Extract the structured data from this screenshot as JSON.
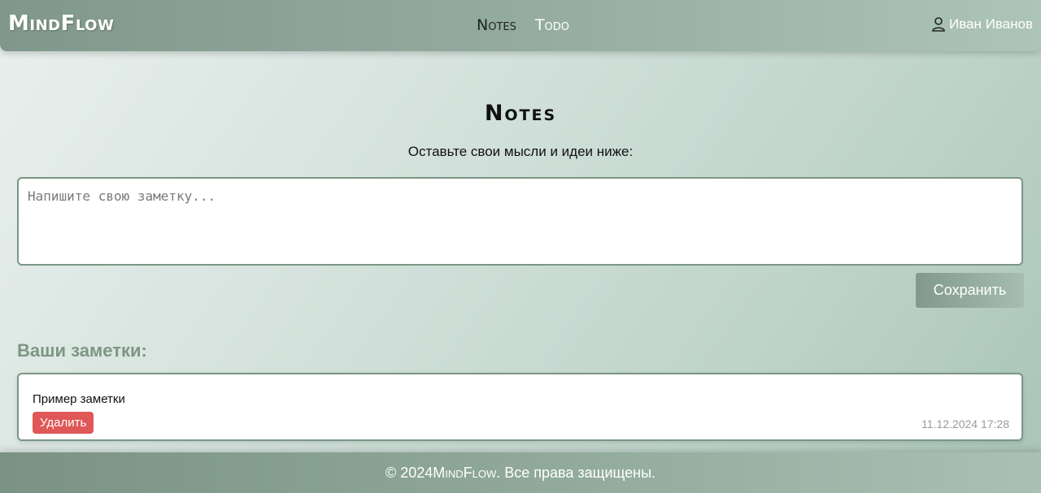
{
  "header": {
    "logo": "MindFlow",
    "nav": [
      {
        "label": "Notes",
        "active": true
      },
      {
        "label": "Todo",
        "active": false
      }
    ],
    "user_name": "Иван Иванов",
    "user_icon": "user-icon"
  },
  "main": {
    "title": "Notes",
    "subtitle": "Оставьте свои мысли и идеи ниже:",
    "input": {
      "value": "",
      "placeholder": "Напишите свою заметку..."
    },
    "save_label": "Сохранить",
    "notes_heading": "Ваши заметки:",
    "notes": [
      {
        "text": "Пример заметки",
        "delete_label": "Удалить",
        "date": "11.12.2024 17:28"
      }
    ]
  },
  "footer": {
    "prefix": "© 2024 ",
    "brand": "MindFlow",
    "suffix": ". Все права защищены."
  },
  "colors": {
    "accent": "#80988b",
    "delete": "#e05757",
    "heading": "#7e9584"
  }
}
